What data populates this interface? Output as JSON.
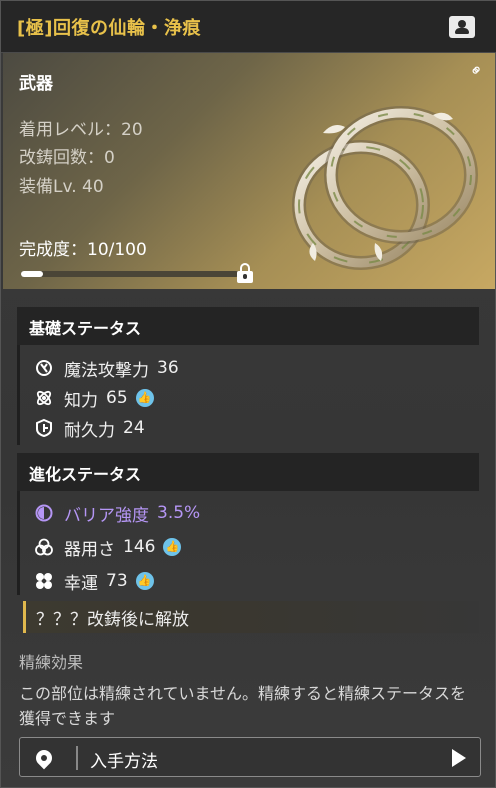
{
  "header": {
    "title": "[極]回復の仙輪・浄痕"
  },
  "hero": {
    "category": "武器",
    "stats": [
      "着用レベル：20",
      "改鋳回数：0",
      "装備Lv. 40"
    ],
    "completion_label": "完成度：10/100",
    "completion_fraction": 0.1
  },
  "basic": {
    "title": "基礎ステータス",
    "rows": [
      {
        "label": "魔法攻撃力",
        "value": "36"
      },
      {
        "label": "知力",
        "value": "65"
      },
      {
        "label": "耐久力",
        "value": "24"
      }
    ]
  },
  "evolution": {
    "title": "進化ステータス",
    "rows": [
      {
        "label": "バリア強度",
        "value": "3.5%"
      },
      {
        "label": "器用さ",
        "value": "146"
      },
      {
        "label": "幸運",
        "value": "73"
      }
    ],
    "locked": "？？？改鋳後に解放"
  },
  "refine": {
    "title": "精練効果",
    "text": "この部位は精練されていません。精練すると精練ステータスを獲得できます"
  },
  "acquire": {
    "label": "入手方法"
  },
  "colors": {
    "title": "#e8c14a",
    "purple_stat": "#b596f5",
    "thumb": "#6ec3ea",
    "locked_bar": "#e0b84d"
  },
  "icons": [
    "profile-icon",
    "link-icon",
    "lock-icon",
    "magic-attack-icon",
    "intellect-icon",
    "durability-icon",
    "barrier-icon",
    "dexterity-icon",
    "luck-icon",
    "thumbs-up-icon",
    "location-pin-icon",
    "arrow-right-icon"
  ]
}
